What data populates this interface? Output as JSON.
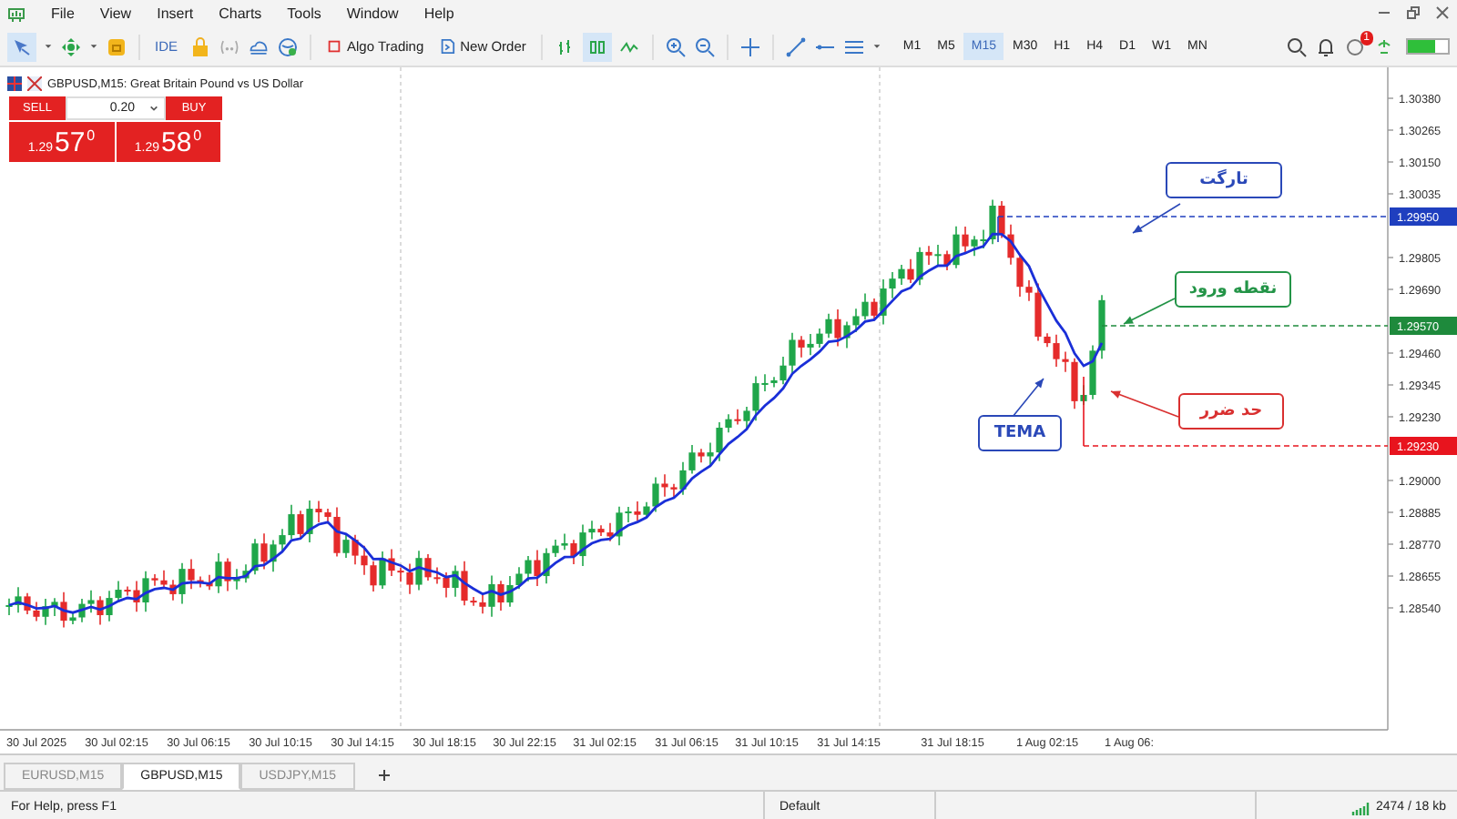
{
  "menu_bar": {
    "items": [
      "File",
      "View",
      "Insert",
      "Charts",
      "Tools",
      "Window",
      "Help"
    ]
  },
  "toolbar": {
    "buttons": [
      "IDE",
      "Algo Trading",
      "New Order"
    ],
    "timeframes": [
      {
        "label": "M1",
        "selected": false
      },
      {
        "label": "M5",
        "selected": false
      },
      {
        "label": "M15",
        "selected": true
      },
      {
        "label": "M30",
        "selected": false
      },
      {
        "label": "H1",
        "selected": false
      },
      {
        "label": "H4",
        "selected": false
      },
      {
        "label": "D1",
        "selected": false
      },
      {
        "label": "W1",
        "selected": false
      },
      {
        "label": "MN",
        "selected": false
      }
    ],
    "notification_badge": "1",
    "connection_meter": {
      "level": 0.7
    }
  },
  "chart": {
    "symbol_title": "GBPUSD,M15:  Great Britain Pound vs US Dollar",
    "trade_panel": {
      "sell_label": "SELL",
      "volume": "0.20",
      "buy_label": "BUY",
      "sell_price": {
        "prefix": "1.29",
        "big": "57",
        "sup": "0"
      },
      "buy_price": {
        "prefix": "1.29",
        "big": "58",
        "sup": "0"
      }
    },
    "price_ticks": [
      "1.30380",
      "1.30265",
      "1.30150",
      "1.30035",
      "1.29805",
      "1.29690",
      "1.29460",
      "1.29345",
      "1.29230",
      "1.29000",
      "1.28885",
      "1.28770",
      "1.28655",
      "1.28540"
    ],
    "price_tags": [
      {
        "text": "1.29950",
        "color": "#1f3fbf"
      },
      {
        "text": "1.29570",
        "color": "#1e8a3c"
      },
      {
        "text": "1.29230",
        "color": "#e8141e"
      }
    ],
    "annotations": [
      {
        "text": "تارگت",
        "color": "#2a48b8"
      },
      {
        "text": "نقطه ورود",
        "color": "#239447"
      },
      {
        "text": "حد ضرر",
        "color": "#d93030"
      },
      {
        "text": "TEMA",
        "color": "#2a48b8"
      }
    ],
    "time_labels": [
      "30 Jul 2025",
      "30 Jul 02:15",
      "30 Jul 06:15",
      "30 Jul 10:15",
      "30 Jul 14:15",
      "30 Jul 18:15",
      "30 Jul 22:15",
      "31 Jul 02:15",
      "31 Jul 06:15",
      "31 Jul 10:15",
      "31 Jul 14:15",
      "31 Jul 18:15",
      "1 Aug 02:15",
      "1 Aug 06:"
    ]
  },
  "tabs": [
    {
      "label": "EURUSD,M15",
      "selected": false
    },
    {
      "label": "GBPUSD,M15",
      "selected": true
    },
    {
      "label": "USDJPY,M15",
      "selected": false
    }
  ],
  "status_bar": {
    "help": "For Help, press F1",
    "profile": "Default",
    "traffic": "2474 / 18 kb"
  }
}
